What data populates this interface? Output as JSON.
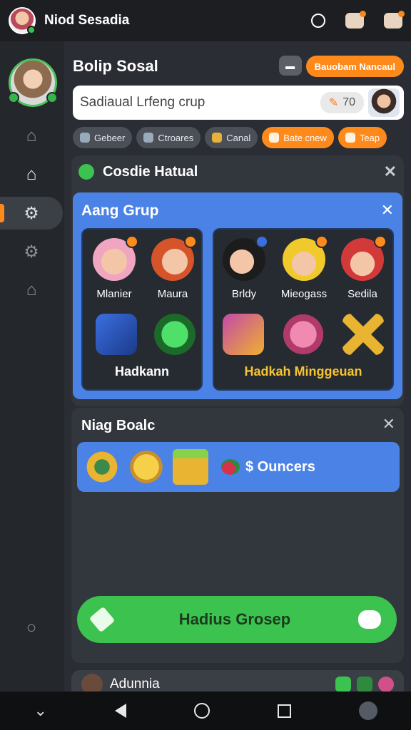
{
  "status_bar": {
    "username": "Niod Sesadia",
    "icons": [
      "circle-icon",
      "notification-icon",
      "settings-icon"
    ]
  },
  "sidebar": {
    "items": [
      {
        "name": "home-outline-icon",
        "glyph": "⌂"
      },
      {
        "name": "home-filled-icon",
        "glyph": "⌂"
      },
      {
        "name": "gear-icon",
        "glyph": "⚙",
        "active": true
      },
      {
        "name": "gear-icon-2",
        "glyph": "⚙"
      },
      {
        "name": "shop-icon",
        "glyph": "⌂"
      },
      {
        "name": "search-icon",
        "glyph": "○"
      }
    ]
  },
  "header": {
    "title": "Bolip Sosal",
    "action_label": "Bauobam Nancaul"
  },
  "search": {
    "placeholder": "Sadiaual Lrfeng crup",
    "count": "70"
  },
  "chips": [
    "Gebeer",
    "Ctroares",
    "Canal",
    "Bate cnew",
    "Teap"
  ],
  "card_one": {
    "title": "Cosdie Hatual",
    "panel_title": "Aang Grup",
    "left_group": {
      "members": [
        "Mlanier",
        "Maura"
      ],
      "label": "Hadkann"
    },
    "right_group": {
      "members": [
        "Brldy",
        "Mieogass",
        "Sedila"
      ],
      "label": "Hadkah Minggeuan"
    }
  },
  "card_two": {
    "title": "Niag Boalc",
    "currency_label": "$ Ouncers",
    "button_label": "Hadius Grosep"
  },
  "peek_row": {
    "label": "Adunnia"
  },
  "colors": {
    "accent": "#ff8a1c",
    "panel_blue": "#4a82e6",
    "button_green": "#3cc24e"
  }
}
